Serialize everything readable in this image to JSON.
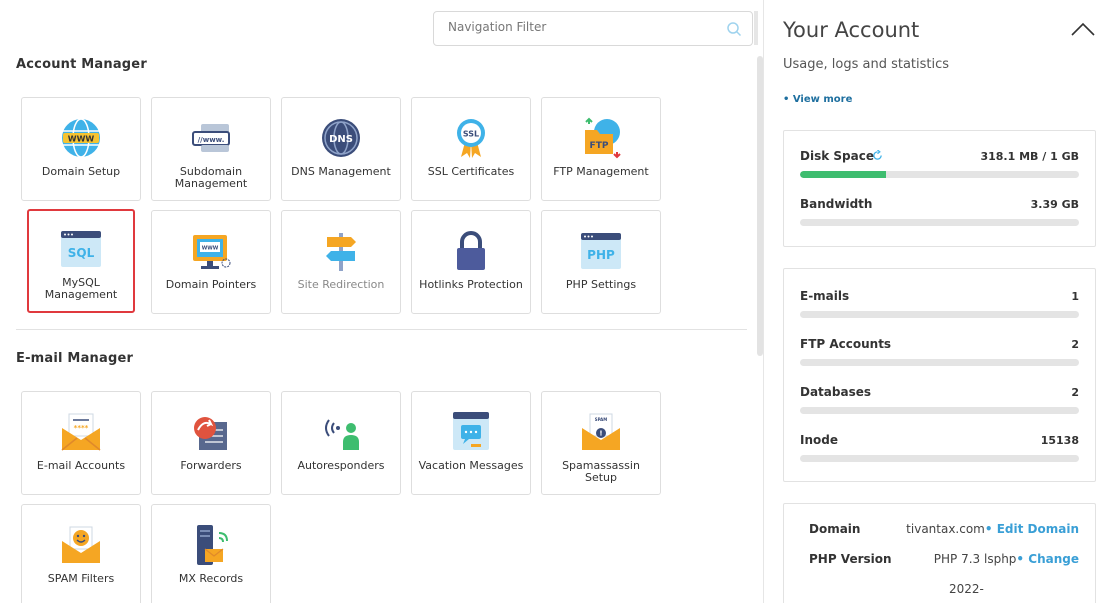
{
  "search": {
    "placeholder": "Navigation Filter"
  },
  "account_manager": {
    "title": "Account Manager",
    "tiles": [
      {
        "label": "Domain Setup",
        "icon": "globe-www-icon"
      },
      {
        "label": "Subdomain Management",
        "icon": "subdomain-icon"
      },
      {
        "label": "DNS Management",
        "icon": "dns-icon"
      },
      {
        "label": "SSL Certificates",
        "icon": "ssl-icon"
      },
      {
        "label": "FTP Management",
        "icon": "ftp-icon"
      },
      {
        "label": "MySQL Management",
        "icon": "sql-icon"
      },
      {
        "label": "Domain Pointers",
        "icon": "domain-pointer-icon"
      },
      {
        "label": "Site Redirection",
        "icon": "signpost-icon"
      },
      {
        "label": "Hotlinks Protection",
        "icon": "lock-icon"
      },
      {
        "label": "PHP Settings",
        "icon": "php-icon"
      }
    ]
  },
  "email_manager": {
    "title": "E-mail Manager",
    "tiles": [
      {
        "label": "E-mail Accounts",
        "icon": "mail-stars-icon"
      },
      {
        "label": "Forwarders",
        "icon": "forward-icon"
      },
      {
        "label": "Autoresponders",
        "icon": "autoresponder-icon"
      },
      {
        "label": "Vacation Messages",
        "icon": "vacation-icon"
      },
      {
        "label": "Spamassassin Setup",
        "icon": "spam-mail-icon"
      },
      {
        "label": "SPAM Filters",
        "icon": "spam-filter-icon"
      },
      {
        "label": "MX Records",
        "icon": "mx-records-icon"
      }
    ]
  },
  "account": {
    "title": "Your Account",
    "subtitle": "Usage, logs and statistics",
    "view_more": "• View more",
    "usage": [
      {
        "name": "Disk Space",
        "value": "318.1 MB / 1 GB",
        "percent": 31
      },
      {
        "name": "Bandwidth",
        "value": "3.39 GB",
        "percent": 0
      }
    ],
    "counts": [
      {
        "name": "E-mails",
        "value": "1"
      },
      {
        "name": "FTP Accounts",
        "value": "2"
      },
      {
        "name": "Databases",
        "value": "2"
      },
      {
        "name": "Inode",
        "value": "15138"
      }
    ],
    "info": [
      {
        "key": "Domain",
        "value": "tivantax.com",
        "link": "• Edit Domain"
      },
      {
        "key": "PHP Version",
        "value": "PHP 7.3 lsphp",
        "link": "• Change"
      },
      {
        "key": "",
        "value": "2022-",
        "link": ""
      }
    ]
  },
  "colors": {
    "accent": "#3a9fd6",
    "progress": "#3ebd6f",
    "highlight": "#e0393e"
  }
}
